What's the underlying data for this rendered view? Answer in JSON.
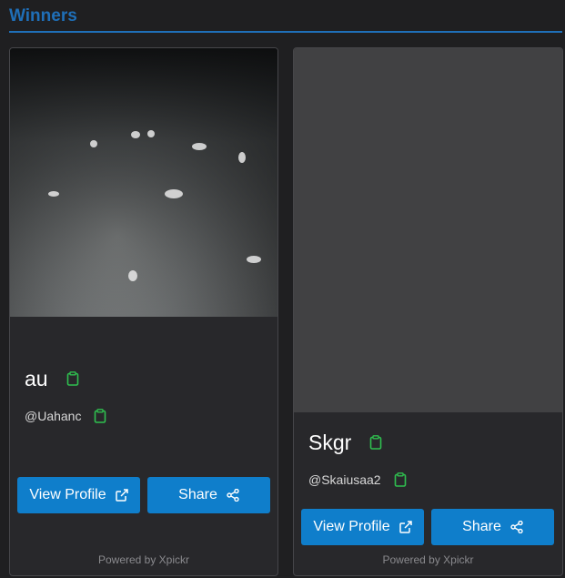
{
  "header": {
    "title": "Winners"
  },
  "cards": [
    {
      "name": "au",
      "handle": "@Uahanc",
      "view_profile_label": "View Profile",
      "share_label": "Share",
      "powered_by": "Powered by Xpickr"
    },
    {
      "name": "Skgr",
      "handle": "@Skaiusaa2",
      "view_profile_label": "View Profile",
      "share_label": "Share",
      "powered_by": "Powered by Xpickr"
    }
  ],
  "colors": {
    "accent": "#1f6fb8",
    "button": "#0f7ecb",
    "copy_icon": "#2fbf4f",
    "background": "#1f1f21",
    "card": "#28282b"
  },
  "icons": {
    "copy": "clipboard-icon",
    "external": "external-link-icon",
    "share": "share-icon"
  }
}
